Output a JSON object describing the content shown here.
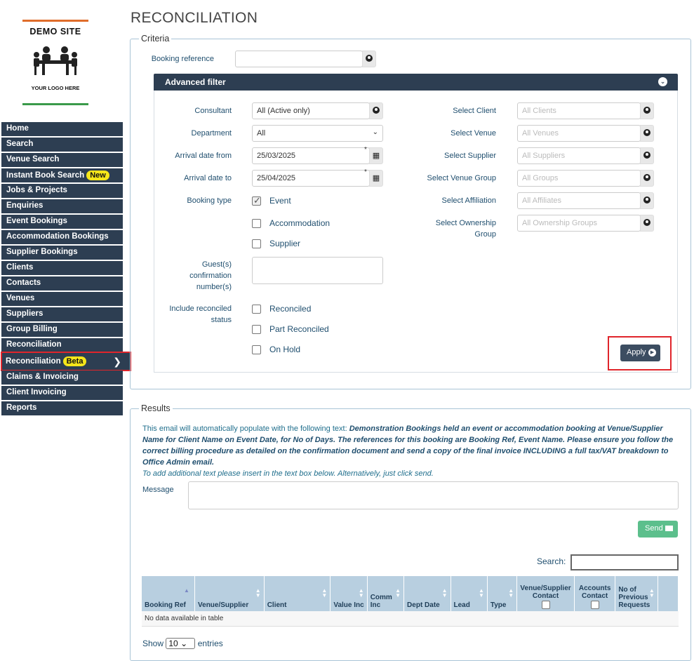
{
  "logo": {
    "site_name": "DEMO SITE",
    "tagline": "YOUR LOGO HERE"
  },
  "sidebar": {
    "items": [
      {
        "label": "Home"
      },
      {
        "label": "Search"
      },
      {
        "label": "Venue Search"
      },
      {
        "label": "Instant Book Search",
        "badge": "New"
      },
      {
        "label": "Jobs & Projects"
      },
      {
        "label": "Enquiries"
      },
      {
        "label": "Event Bookings"
      },
      {
        "label": "Accommodation Bookings"
      },
      {
        "label": "Supplier Bookings"
      },
      {
        "label": "Clients"
      },
      {
        "label": "Contacts"
      },
      {
        "label": "Venues"
      },
      {
        "label": "Suppliers"
      },
      {
        "label": "Group Billing"
      },
      {
        "label": "Reconciliation"
      },
      {
        "label": "Reconciliation",
        "badge": "Beta",
        "active": true
      },
      {
        "label": "Claims & Invoicing"
      },
      {
        "label": "Client Invoicing"
      },
      {
        "label": "Reports"
      }
    ]
  },
  "page": {
    "title": "RECONCILIATION"
  },
  "criteria": {
    "legend": "Criteria",
    "booking_reference_label": "Booking reference",
    "booking_reference_value": "",
    "advanced_filter": {
      "title": "Advanced filter",
      "consultant": {
        "label": "Consultant",
        "value": "All (Active only)"
      },
      "department": {
        "label": "Department",
        "value": "All"
      },
      "arrival_from": {
        "label": "Arrival date from",
        "value": "25/03/2025"
      },
      "arrival_to": {
        "label": "Arrival date to",
        "value": "25/04/2025"
      },
      "booking_type": {
        "label": "Booking type",
        "options": [
          {
            "label": "Event",
            "checked": true
          },
          {
            "label": "Accommodation",
            "checked": false
          },
          {
            "label": "Supplier",
            "checked": false
          }
        ]
      },
      "guest_confirmation_label": "Guest(s) confirmation number(s)",
      "include_reconciled": {
        "label": "Include reconciled status",
        "options": [
          {
            "label": "Reconciled",
            "checked": false
          },
          {
            "label": "Part Reconciled",
            "checked": false
          },
          {
            "label": "On Hold",
            "checked": false
          }
        ]
      },
      "select_client": {
        "label": "Select Client",
        "placeholder": "All Clients"
      },
      "select_venue": {
        "label": "Select Venue",
        "placeholder": "All Venues"
      },
      "select_supplier": {
        "label": "Select Supplier",
        "placeholder": "All Suppliers"
      },
      "select_venue_group": {
        "label": "Select Venue Group",
        "placeholder": "All Groups"
      },
      "select_affiliation": {
        "label": "Select Affiliation",
        "placeholder": "All Affiliates"
      },
      "select_ownership_group": {
        "label": "Select Ownership Group",
        "placeholder": "All Ownership Groups"
      },
      "apply_label": "Apply"
    }
  },
  "results": {
    "legend": "Results",
    "info_prefix": "This email will automatically populate with the following text: ",
    "info_italic": "Demonstration Bookings held an event or accommodation booking at Venue/Supplier Name for Client Name on Event Date, for No of Days. The references for this booking are Booking Ref, Event Name. Please ensure you follow the correct billing procedure as detailed on the confirmation document and send a copy of the final invoice INCLUDING a full tax/VAT breakdown to Office Admin email.",
    "info_hint": "To add additional text please insert in the text box below. Alternatively, just click send.",
    "message_label": "Message",
    "send_label": "Send",
    "search_label": "Search:",
    "columns": [
      "Booking Ref",
      "Venue/Supplier",
      "Client",
      "Value Inc",
      "Comm Inc",
      "Dept Date",
      "Lead",
      "Type",
      "Venue/Supplier Contact",
      "Accounts Contact",
      "No of Previous Requests"
    ],
    "empty_text": "No data available in table",
    "show_label": "Show",
    "page_size": "10",
    "entries_label": "entries"
  }
}
